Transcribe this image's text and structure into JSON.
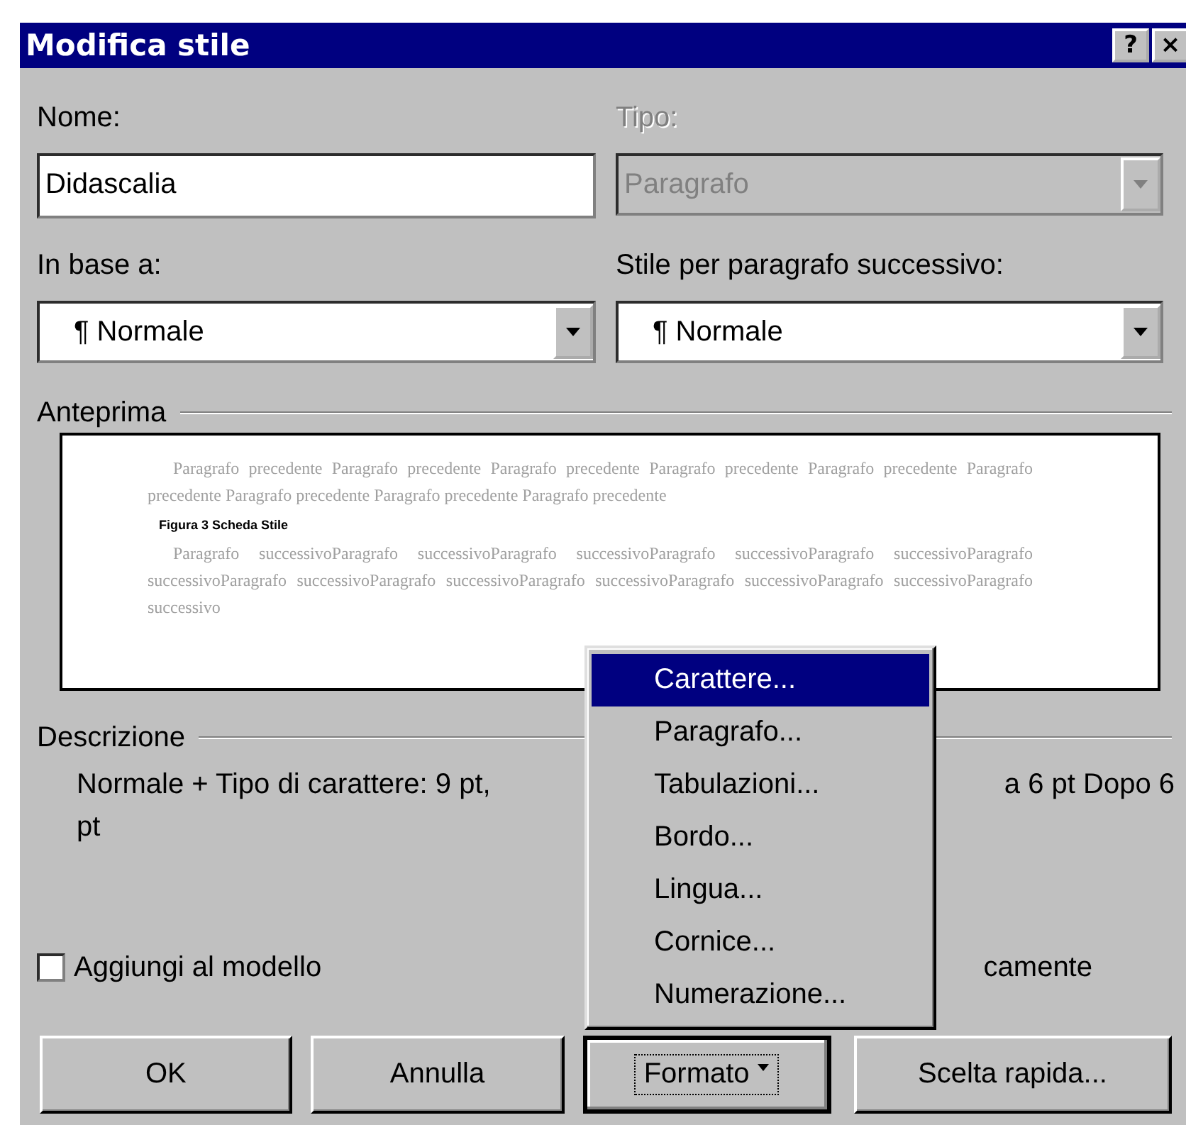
{
  "window": {
    "title": "Modifica stile",
    "help_button": "?",
    "close_button": "×"
  },
  "name_field": {
    "label": "Nome:",
    "value": "Didascalia"
  },
  "type_field": {
    "label": "Tipo:",
    "value": "Paragrafo",
    "disabled": true
  },
  "based_on": {
    "label": "In base a:",
    "value": "¶ Normale",
    "disabled": false
  },
  "next_style": {
    "label": "Stile per paragrafo successivo:",
    "value": "¶ Normale",
    "disabled": false
  },
  "preview": {
    "title": "Anteprima",
    "previous_text": "Paragrafo precedente Paragrafo precedente Paragrafo precedente Paragrafo precedente Paragrafo precedente Paragrafo precedente Paragrafo precedente Paragrafo precedente Paragrafo precedente",
    "caption": "Figura 3 Scheda Stile",
    "next_text": "Paragrafo successivoParagrafo successivoParagrafo successivoParagrafo successivoParagrafo successivoParagrafo successivoParagrafo successivoParagrafo successivoParagrafo successivoParagrafo successivoParagrafo successivoParagrafo successivo"
  },
  "description": {
    "title": "Descrizione",
    "text_left": "Normale + Tipo di carattere: 9 pt,",
    "text_right": "a 6 pt  Dopo 6",
    "text_wrap": "pt"
  },
  "checkboxes": [
    {
      "label": "Aggiungi al modello",
      "checked": false
    }
  ],
  "partial_label": "camente",
  "buttons": [
    {
      "label": "OK",
      "kind": "plain",
      "focused": false
    },
    {
      "label": "Annulla",
      "kind": "plain",
      "focused": false
    },
    {
      "label": "Formato",
      "kind": "menu",
      "focused": true
    },
    {
      "label": "Scelta rapida...",
      "kind": "plain",
      "focused": false
    }
  ],
  "menu": {
    "items": [
      {
        "label": "Carattere...",
        "selected": true
      },
      {
        "label": "Paragrafo...",
        "selected": false
      },
      {
        "label": "Tabulazioni...",
        "selected": false
      },
      {
        "label": "Bordo...",
        "selected": false
      },
      {
        "label": "Lingua...",
        "selected": false
      },
      {
        "label": "Cornice...",
        "selected": false
      },
      {
        "label": "Numerazione...",
        "selected": false
      }
    ]
  }
}
